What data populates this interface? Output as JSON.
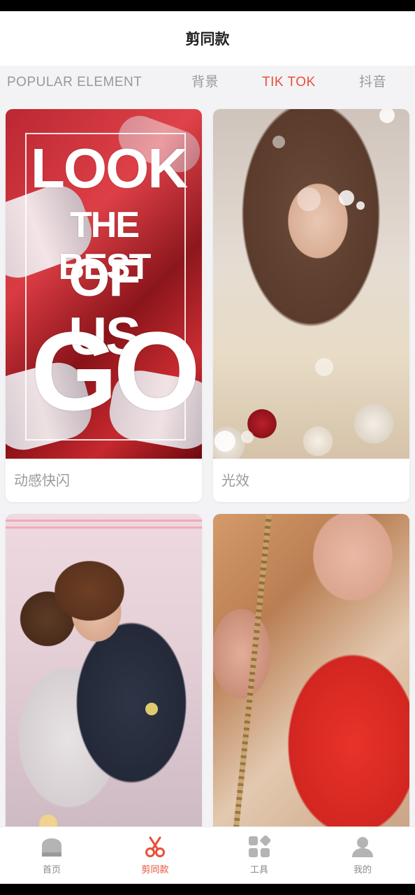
{
  "header": {
    "title": "剪同款"
  },
  "tabs": [
    {
      "label": "POPULAR ELEMENT",
      "active": false
    },
    {
      "label": "背景",
      "active": false
    },
    {
      "label": "TIK TOK",
      "active": true
    },
    {
      "label": "抖音",
      "active": false
    }
  ],
  "cards": [
    {
      "label": "动感快闪",
      "poster_lines": [
        "LOOK",
        "THE BEST",
        "OF US",
        "GO"
      ]
    },
    {
      "label": "光效"
    },
    {
      "label": ""
    },
    {
      "label": ""
    }
  ],
  "bottom_nav": [
    {
      "label": "首页",
      "icon": "home-icon",
      "active": false
    },
    {
      "label": "剪同款",
      "icon": "scissors-icon",
      "active": true
    },
    {
      "label": "工具",
      "icon": "tools-icon",
      "active": false
    },
    {
      "label": "我的",
      "icon": "user-icon",
      "active": false
    }
  ],
  "colors": {
    "accent": "#e8503a",
    "inactive": "#999999",
    "background": "#f3f3f5"
  }
}
